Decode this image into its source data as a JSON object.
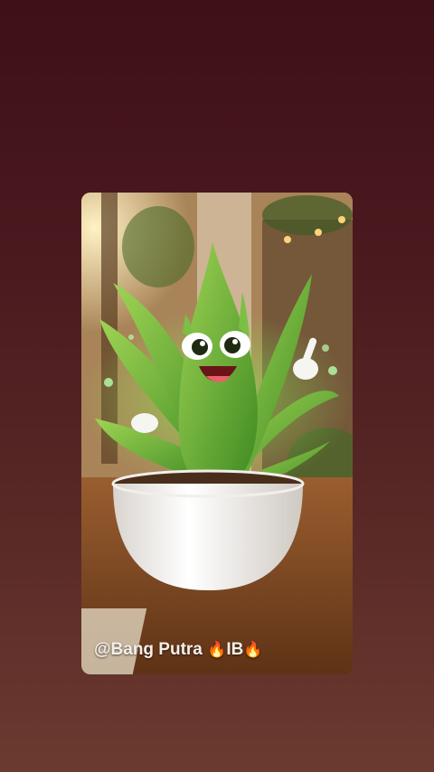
{
  "watermark": {
    "handle": "@Bang Putra",
    "suffix": "IB",
    "icon": "fire-icon"
  }
}
